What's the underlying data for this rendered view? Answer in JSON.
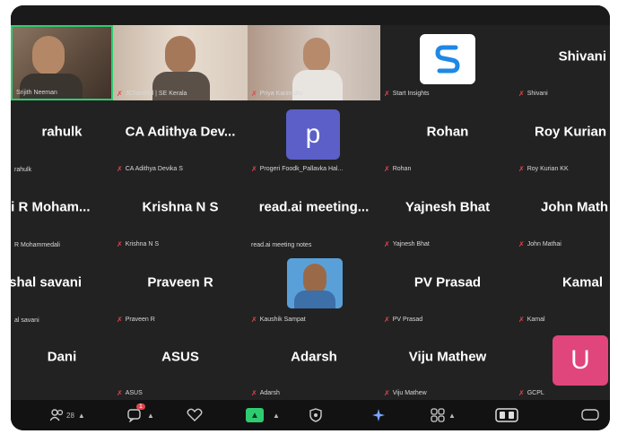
{
  "participants": [
    {
      "name": "",
      "label": "Srijith Neeman",
      "mic": false,
      "video": true
    },
    {
      "name": "",
      "label": "JChanthul | SE Kerala",
      "mic": true,
      "video": true
    },
    {
      "name": "",
      "label": "Priya Karimuttu",
      "mic": true,
      "video": true
    },
    {
      "name": "",
      "label": "Start Insights",
      "mic": true,
      "avatar": "logo"
    },
    {
      "name": "Shivani",
      "label": "Shivani",
      "mic": true
    },
    {
      "name": "rahulk",
      "label": "rahulk",
      "mic": false
    },
    {
      "name": "CA Adithya Dev...",
      "label": "CA Adithya Devika S",
      "mic": true
    },
    {
      "name": "",
      "label": "Progeri Foodk_Pallavka Hal...",
      "mic": true,
      "avatar": "P"
    },
    {
      "name": "Rohan",
      "label": "Rohan",
      "mic": true
    },
    {
      "name": "Roy Kurian",
      "label": "Roy Kurian KK",
      "mic": true
    },
    {
      "name": "ji R Moham...",
      "label": "R Mohammedali",
      "mic": false
    },
    {
      "name": "Krishna N S",
      "label": "Krishna N S",
      "mic": true
    },
    {
      "name": "read.ai meeting...",
      "label": "read.ai meeting notes",
      "mic": false
    },
    {
      "name": "Yajnesh Bhat",
      "label": "Yajnesh Bhat",
      "mic": true
    },
    {
      "name": "John Math",
      "label": "John Mathai",
      "mic": true
    },
    {
      "name": "ishal savani",
      "label": "al savani",
      "mic": false
    },
    {
      "name": "Praveen R",
      "label": "Praveen R",
      "mic": true
    },
    {
      "name": "",
      "label": "Kaushik Sampat",
      "mic": true,
      "avatar": "photo"
    },
    {
      "name": "PV Prasad",
      "label": "PV Prasad",
      "mic": true
    },
    {
      "name": "Kamal",
      "label": "Kamal",
      "mic": true
    },
    {
      "name": "Dani",
      "label": "",
      "mic": false
    },
    {
      "name": "ASUS",
      "label": "ASUS",
      "mic": true
    },
    {
      "name": "Adarsh",
      "label": "Adarsh",
      "mic": true
    },
    {
      "name": "Viju Mathew",
      "label": "Viju Mathew",
      "mic": true
    },
    {
      "name": "",
      "label": "GCPL",
      "mic": true,
      "avatar": "U"
    }
  ],
  "avatar_letters": {
    "p": "p",
    "u": "U"
  },
  "colors": {
    "avatar_p": "#5b5fc7",
    "avatar_u": "#e0457b",
    "active_border": "#2ecc71",
    "mic_muted": "#e0444c"
  },
  "toolbar": {
    "participants_count": "28",
    "chat_badge": "1",
    "icons": [
      "participants-icon",
      "chat-icon",
      "react-icon",
      "share-icon",
      "security-icon",
      "ai-icon",
      "apps-icon",
      "layout-icon",
      "more-icon"
    ]
  }
}
